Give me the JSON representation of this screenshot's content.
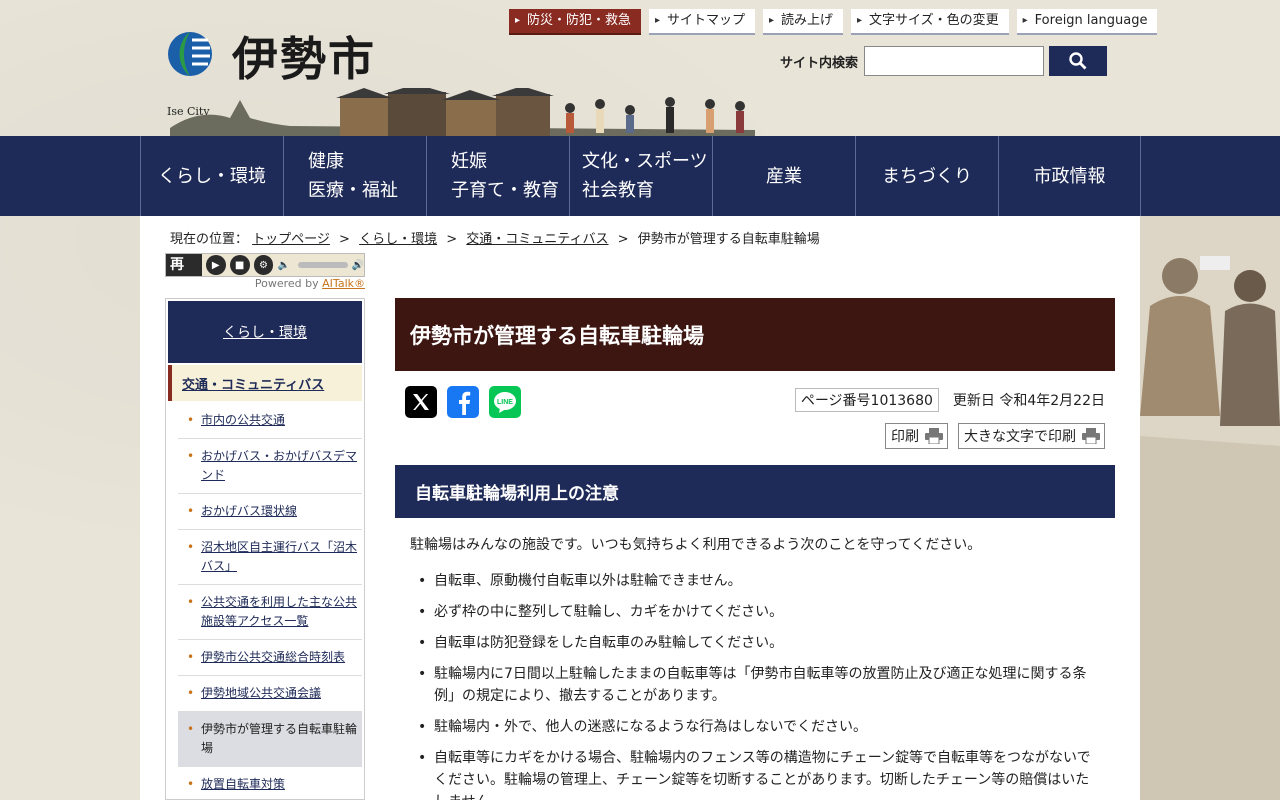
{
  "header": {
    "logo_name": "伊勢市",
    "logo_city": "Ise City",
    "top_links": [
      "防災・防犯・救急",
      "サイトマップ",
      "読み上げ",
      "文字サイズ・色の変更",
      "Foreign language"
    ],
    "search_label": "サイト内検索",
    "search_value": ""
  },
  "nav": {
    "items": [
      "くらし・環境",
      "健康\n医療・福祉",
      "妊娠\n子育て・教育",
      "文化・スポーツ\n社会教育",
      "産業",
      "まちづくり",
      "市政情報"
    ]
  },
  "breadcrumb": {
    "prefix": "現在の位置：",
    "links": [
      "トップページ",
      "くらし・環境",
      "交通・コミュニティバス"
    ],
    "current": "伊勢市が管理する自転車駐輪場",
    "separator": ">"
  },
  "tts": {
    "play": "再生",
    "powered_by": "Powered by",
    "brand": "AITalk®"
  },
  "sidebar": {
    "heading": "くらし・環境",
    "category": "交通・コミュニティバス",
    "items": [
      "市内の公共交通",
      "おかげバス・おかげバスデマンド",
      "おかげバス環状線",
      "沼木地区自主運行バス「沼木バス」",
      "公共交通を利用した主な公共施設等アクセス一覧",
      "伊勢市公共交通総合時刻表",
      "伊勢地域公共交通会議",
      "伊勢市が管理する自転車駐輪場",
      "放置自転車対策"
    ]
  },
  "main": {
    "title": "伊勢市が管理する自転車駐輪場",
    "page_number": "ページ番号1013680",
    "updated": "更新日 令和4年2月22日",
    "print": "印刷",
    "print_large": "大きな文字で印刷",
    "section_heading": "自転車駐輪場利用上の注意",
    "intro": "駐輪場はみんなの施設です。いつも気持ちよく利用できるよう次のことを守ってください。",
    "rules": [
      "自転車、原動機付自転車以外は駐輪できません。",
      "必ず枠の中に整列して駐輪し、カギをかけてください。",
      "自転車は防犯登録をした自転車のみ駐輪してください。",
      "駐輪場内に7日間以上駐輪したままの自転車等は「伊勢市自転車等の放置防止及び適正な処理に関する条例」の規定により、撤去することがあります。",
      "駐輪場内・外で、他人の迷惑になるような行為はしないでください。",
      "自転車等にカギをかける場合、駐輪場内のフェンス等の構造物にチェーン錠等で自転車等をつながないでください。駐輪場の管理上、チェーン錠等を切断することがあります。切断したチェーン等の賠償はいたしません。"
    ]
  },
  "colors": {
    "navy": "#1e2a57",
    "maroon": "#3d1612",
    "disaster": "#8a2b22"
  }
}
